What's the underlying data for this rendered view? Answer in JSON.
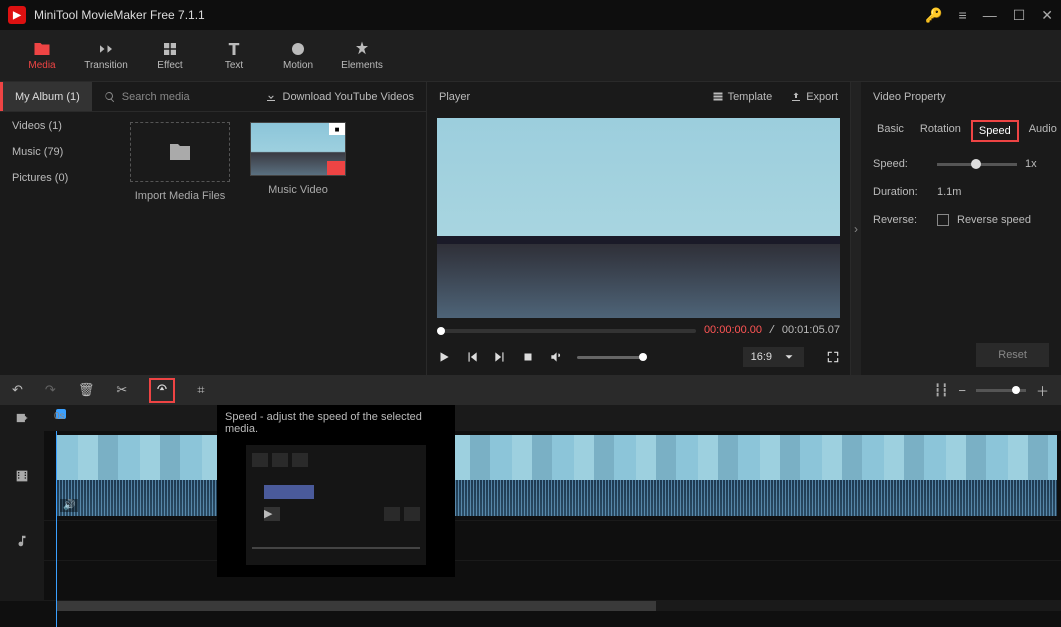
{
  "app": {
    "title": "MiniTool MovieMaker Free 7.1.1"
  },
  "toptabs": {
    "media": "Media",
    "transition": "Transition",
    "effect": "Effect",
    "text": "Text",
    "motion": "Motion",
    "elements": "Elements"
  },
  "mediabar": {
    "album": "My Album (1)",
    "search_placeholder": "Search media",
    "download": "Download YouTube Videos"
  },
  "mediacats": {
    "videos": "Videos (1)",
    "music": "Music (79)",
    "pictures": "Pictures (0)"
  },
  "mediaitems": {
    "import": "Import Media Files",
    "clip1": "Music Video"
  },
  "player": {
    "label": "Player",
    "template": "Template",
    "export": "Export",
    "time_current": "00:00:00.00",
    "time_total": "00:01:05.07",
    "aspect": "16:9"
  },
  "props": {
    "title": "Video Property",
    "tabs": {
      "basic": "Basic",
      "rotation": "Rotation",
      "speed": "Speed",
      "audio": "Audio"
    },
    "speed_label": "Speed:",
    "speed_value": "1x",
    "duration_label": "Duration:",
    "duration_value": "1.1m",
    "reverse_label": "Reverse:",
    "reverse_chk": "Reverse speed",
    "reset": "Reset"
  },
  "timeline": {
    "start": "0s"
  },
  "tooltip": {
    "text": "Speed - adjust the speed of the selected media."
  }
}
